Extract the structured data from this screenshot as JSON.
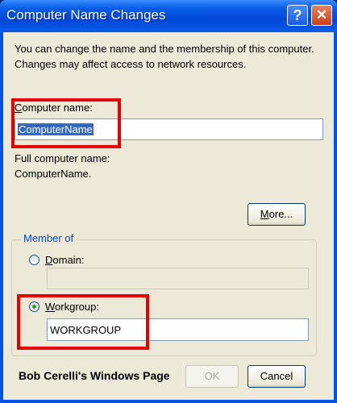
{
  "window": {
    "title": "Computer Name Changes",
    "help_glyph": "?",
    "close_glyph": "✕"
  },
  "intro_text": "You can change the name and the membership of this computer. Changes may affect access to network resources.",
  "computer_name": {
    "label_accel": "C",
    "label_rest": "omputer name:",
    "value": "ComputerName"
  },
  "full_name": {
    "label": "Full computer name:",
    "value": "ComputerName."
  },
  "more_button": {
    "accel": "M",
    "rest": "ore..."
  },
  "member_of": {
    "title": "Member of",
    "domain": {
      "label_accel": "D",
      "label_rest": "omain:",
      "value": "",
      "selected": false
    },
    "workgroup": {
      "label_accel": "W",
      "label_rest": "orkgroup:",
      "value": "WORKGROUP",
      "selected": true
    }
  },
  "watermark": "Bob Cerelli's Windows Page",
  "buttons": {
    "ok": "OK",
    "cancel": "Cancel"
  },
  "colors": {
    "titlebar": "#0054e3",
    "dialog_bg": "#ece9d8",
    "selection": "#316ac5",
    "highlight_box": "#e60000",
    "group_title": "#0046d5"
  }
}
